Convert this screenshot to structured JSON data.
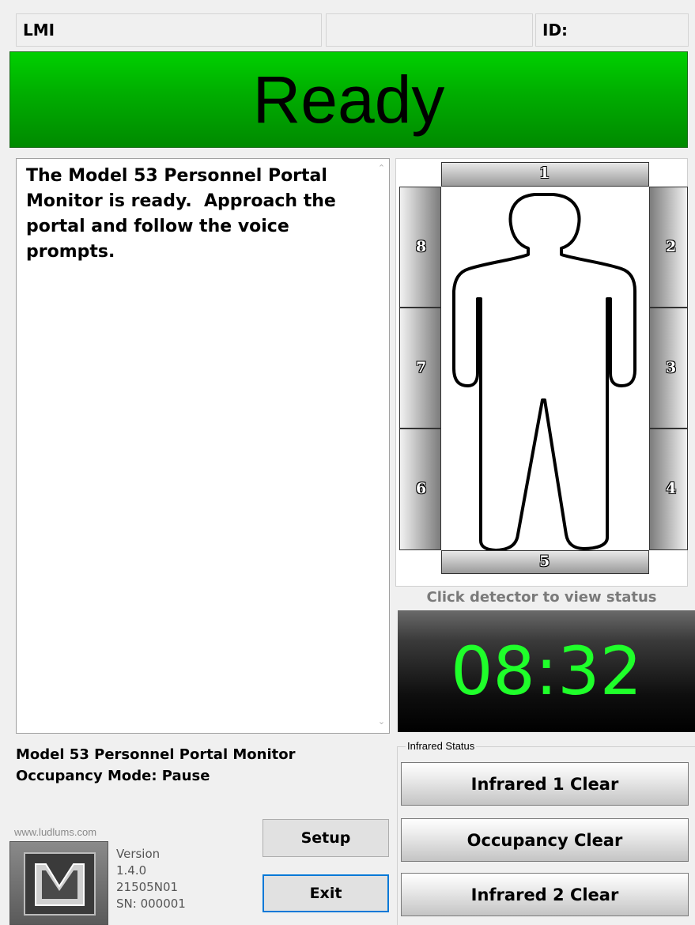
{
  "header": {
    "left_label": "LMI",
    "middle_label": "",
    "right_label": "ID:"
  },
  "status_banner": {
    "text": "Ready",
    "color": "#00b000"
  },
  "message": {
    "text": "The Model 53 Personnel Portal Monitor is ready.  Approach the portal and follow the voice prompts."
  },
  "portal": {
    "detectors": [
      "1",
      "2",
      "3",
      "4",
      "5",
      "6",
      "7",
      "8"
    ],
    "hint": "Click detector to view  status"
  },
  "timer": {
    "value": "08:32",
    "color": "#1fff2a"
  },
  "model_info": {
    "line1": "Model 53 Personnel Portal Monitor",
    "line2": "Occupancy Mode:  Pause"
  },
  "infrared": {
    "title": "Infrared Status",
    "buttons": [
      "Infrared 1 Clear",
      "Occupancy Clear",
      "Infrared 2 Clear"
    ]
  },
  "footer": {
    "url": "www.ludlums.com",
    "version_label": "Version",
    "version_number": "1.4.0",
    "build": "21505N01",
    "serial": "SN: 000001",
    "setup_label": "Setup",
    "exit_label": "Exit"
  }
}
